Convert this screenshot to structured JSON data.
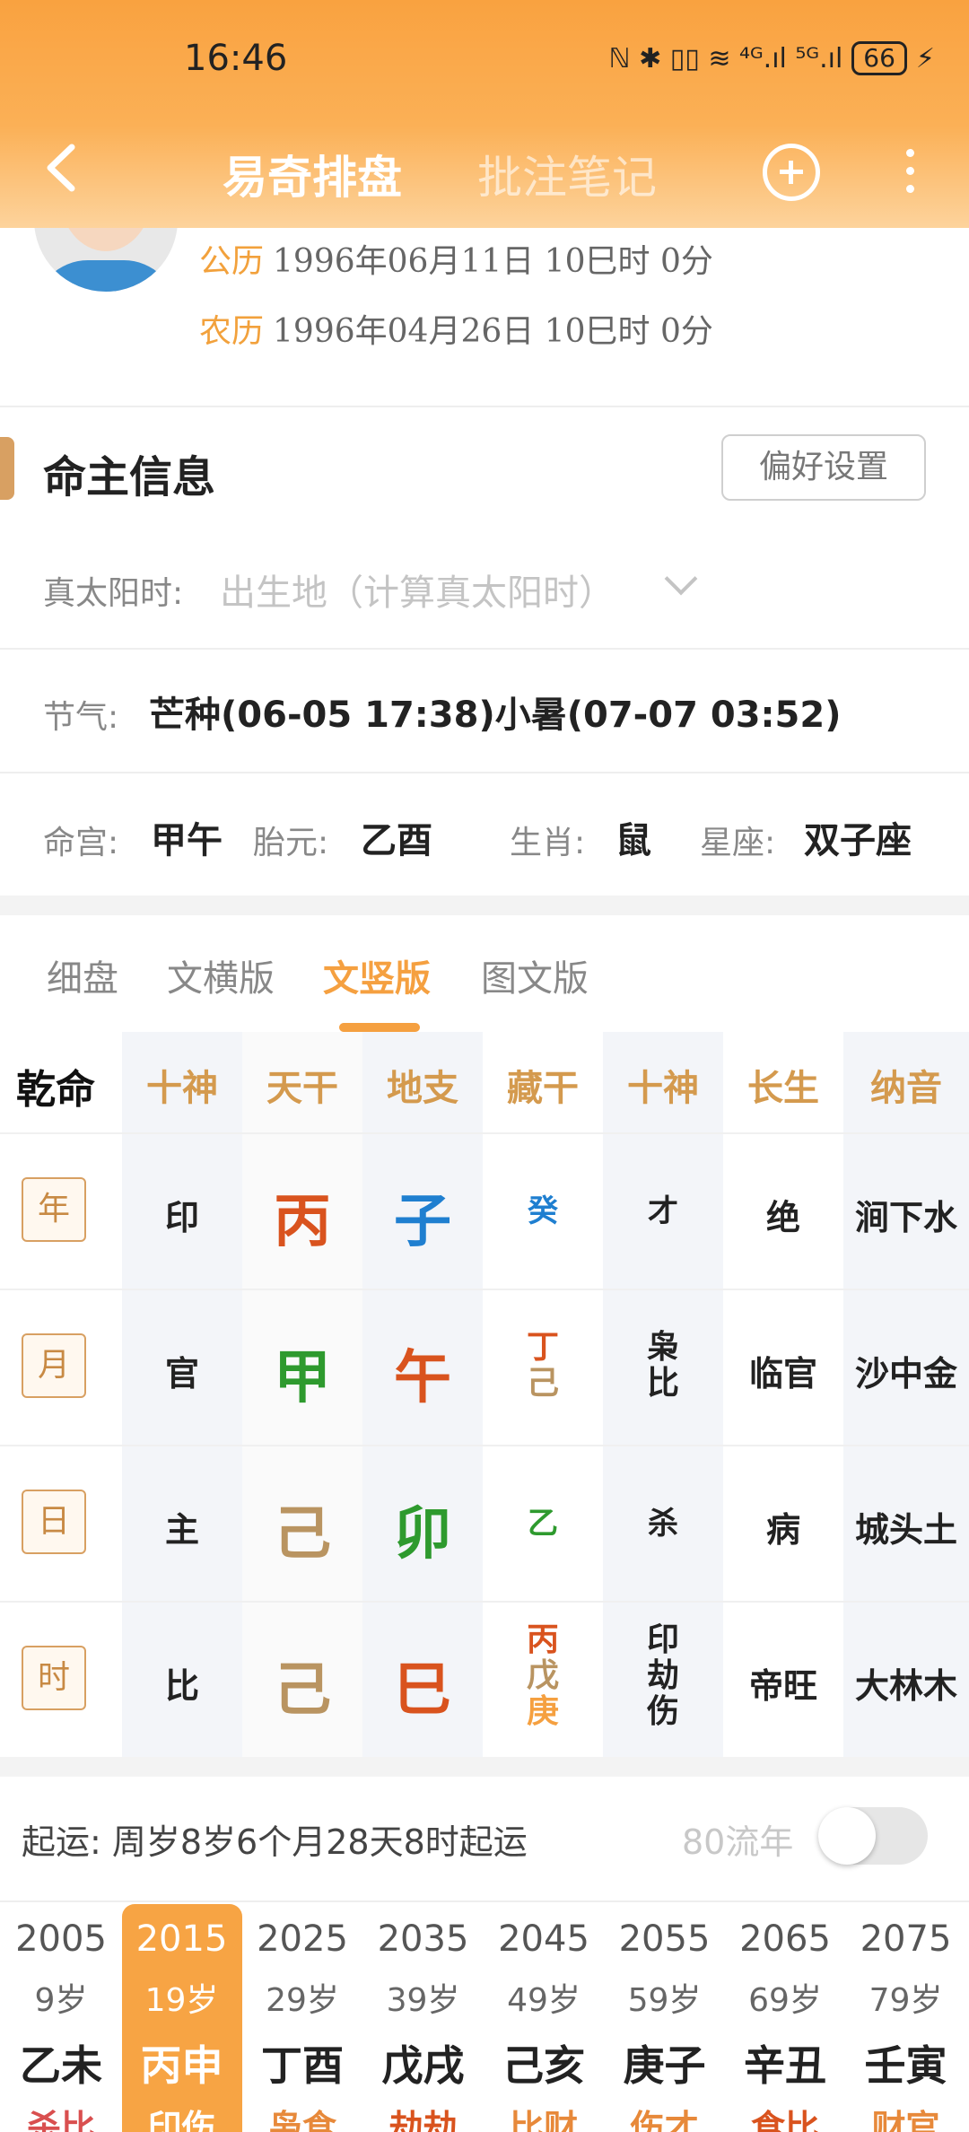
{
  "status": {
    "time": "16:46",
    "icons": "ℕ ✱ ▯▯ ≋ ⁴ᴳ.ıl ⁵ᴳ.ıl",
    "battery": "66",
    "bolt": "⚡"
  },
  "nav": {
    "tab_active": "易奇排盘",
    "tab_inactive": "批注笔记"
  },
  "profile": {
    "solar_label": "公历",
    "solar_value": "1996年06月11日 10巳时 0分",
    "lunar_label": "农历",
    "lunar_value": "1996年04月26日 10巳时 0分"
  },
  "info": {
    "title": "命主信息",
    "pref_button": "偏好设置",
    "true_solar_label": "真太阳时:",
    "birthplace_placeholder": "出生地（计算真太阳时）",
    "jieqi_label": "节气:",
    "jieqi_value": "芒种(06-05 17:38)小暑(07-07 03:52)",
    "minggong_label": "命宫:",
    "minggong_value": "甲午",
    "taiyuan_label": "胎元:",
    "taiyuan_value": "乙酉",
    "shengxiao_label": "生肖:",
    "shengxiao_value": "鼠",
    "xingzuo_label": "星座:",
    "xingzuo_value": "双子座"
  },
  "view_tabs": [
    "细盘",
    "文横版",
    "文竖版",
    "图文版"
  ],
  "active_tab": "文竖版",
  "grid": {
    "corner": "乾命",
    "headers": [
      "十神",
      "天干",
      "地支",
      "藏干",
      "十神",
      "长生",
      "纳音"
    ],
    "rows": [
      {
        "pillar": "年",
        "shishen": "印",
        "gan": "丙",
        "zhi": "子",
        "canggan": [
          "癸"
        ],
        "shishen2": [
          "才"
        ],
        "changsheng": "绝",
        "nayin": "涧下水"
      },
      {
        "pillar": "月",
        "shishen": "官",
        "gan": "甲",
        "zhi": "午",
        "canggan": [
          "丁",
          "己"
        ],
        "shishen2": [
          "枭",
          "比"
        ],
        "changsheng": "临官",
        "nayin": "沙中金"
      },
      {
        "pillar": "日",
        "shishen": "主",
        "gan": "己",
        "zhi": "卯",
        "canggan": [
          "乙"
        ],
        "shishen2": [
          "杀"
        ],
        "changsheng": "病",
        "nayin": "城头土"
      },
      {
        "pillar": "时",
        "shishen": "比",
        "gan": "己",
        "zhi": "巳",
        "canggan": [
          "丙",
          "戊",
          "庚"
        ],
        "shishen2": [
          "印",
          "劫",
          "伤"
        ],
        "changsheng": "帝旺",
        "nayin": "大林木"
      }
    ],
    "colors": {
      "fire": "#d9531e",
      "water": "#1f7fd0",
      "wood": "#2e9a2e",
      "earth": "#b99461",
      "metal": "#f5a040",
      "header": "#d49a4e"
    }
  },
  "qiyun": {
    "text": "起运:  周岁8岁6个月28天8时起运",
    "liunian_label": "80流年"
  },
  "dayun": [
    {
      "year": "2005",
      "age": "9岁",
      "ganzhi": "乙未",
      "shishen": "杀比"
    },
    {
      "year": "2015",
      "age": "19岁",
      "ganzhi": "丙申",
      "shishen": "印伤"
    },
    {
      "year": "2025",
      "age": "29岁",
      "ganzhi": "丁酉",
      "shishen": "枭食"
    },
    {
      "year": "2035",
      "age": "39岁",
      "ganzhi": "戊戌",
      "shishen": "劫劫"
    },
    {
      "year": "2045",
      "age": "49岁",
      "ganzhi": "己亥",
      "shishen": "比财"
    },
    {
      "year": "2055",
      "age": "59岁",
      "ganzhi": "庚子",
      "shishen": "伤才"
    },
    {
      "year": "2065",
      "age": "69岁",
      "ganzhi": "辛丑",
      "shishen": "食比"
    },
    {
      "year": "2075",
      "age": "79岁",
      "ganzhi": "壬寅",
      "shishen": "财官"
    }
  ],
  "dayun_active_index": 1
}
